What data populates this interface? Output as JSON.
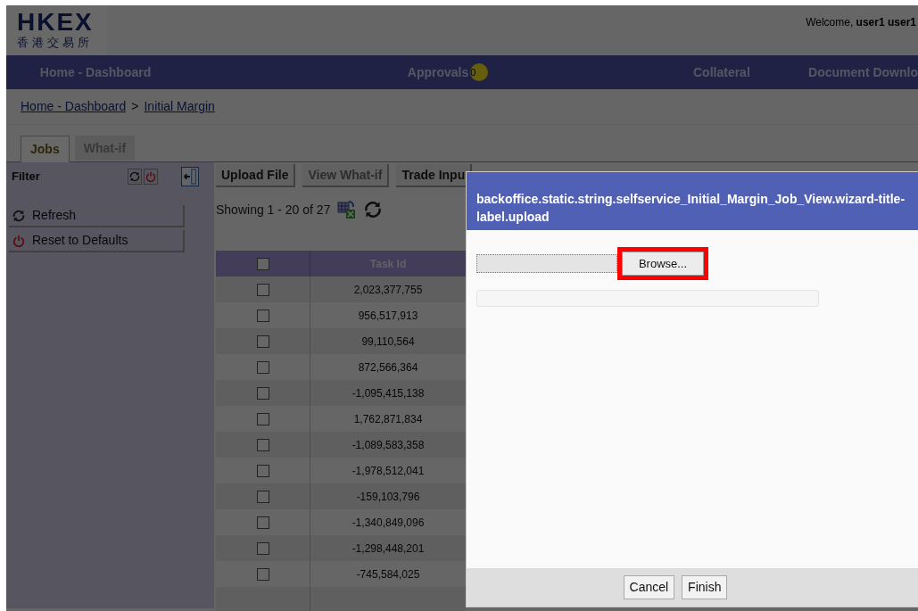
{
  "header": {
    "logo_text": "HKEX",
    "logo_chinese": "香港交易所",
    "welcome": "Welcome, **user1 user1**"
  },
  "nav": [
    {
      "label": "Home - Dashboard"
    },
    {
      "label": "Approvals",
      "badge": "0"
    },
    {
      "label": "Collateral"
    },
    {
      "label": "Document Downlo"
    }
  ],
  "breadcrumb": [
    "Home - Dashboard",
    "Initial Margin"
  ],
  "breadcrumb_separator": ">",
  "tabs": [
    {
      "label": "Jobs",
      "selected": true
    },
    {
      "label": "What-if",
      "selected": false
    }
  ],
  "filter": {
    "title": "Filter",
    "items": [
      {
        "label": "Refresh",
        "kind": "refresh"
      },
      {
        "label": "Reset to Defaults",
        "kind": "reset"
      }
    ]
  },
  "toolbar": [
    {
      "label": "Upload File",
      "disabled": false
    },
    {
      "label": "View What-if",
      "disabled": true
    },
    {
      "label": "Trade Inpu",
      "disabled": false
    }
  ],
  "paging": "Showing 1 - 20 of 27",
  "table": {
    "columns": [
      "Task Id"
    ],
    "header_checked": false,
    "rows": [
      {
        "task_id": "2,023,377,755",
        "checked": false
      },
      {
        "task_id": "956,517,913",
        "checked": false
      },
      {
        "task_id": "99,110,564",
        "checked": false
      },
      {
        "task_id": "872,566,364",
        "checked": false
      },
      {
        "task_id": "-1,095,415,138",
        "checked": false
      },
      {
        "task_id": "1,762,871,834",
        "checked": false
      },
      {
        "task_id": "-1,089,583,358",
        "checked": false
      },
      {
        "task_id": "-1,978,512,041",
        "checked": false
      },
      {
        "task_id": "-159,103,796",
        "checked": false
      },
      {
        "task_id": "-1,340,849,096",
        "checked": false
      },
      {
        "task_id": "-1,298,448,201",
        "checked": false
      },
      {
        "task_id": "-745,584,025",
        "checked": false
      }
    ]
  },
  "dialog": {
    "title": "backoffice.static.string.selfservice_Initial_Margin_Job_View.wizard-title-label.upload",
    "browse_button": "Browse...",
    "browse_highlighted": true,
    "buttons": [
      "Cancel",
      "Finish"
    ]
  }
}
